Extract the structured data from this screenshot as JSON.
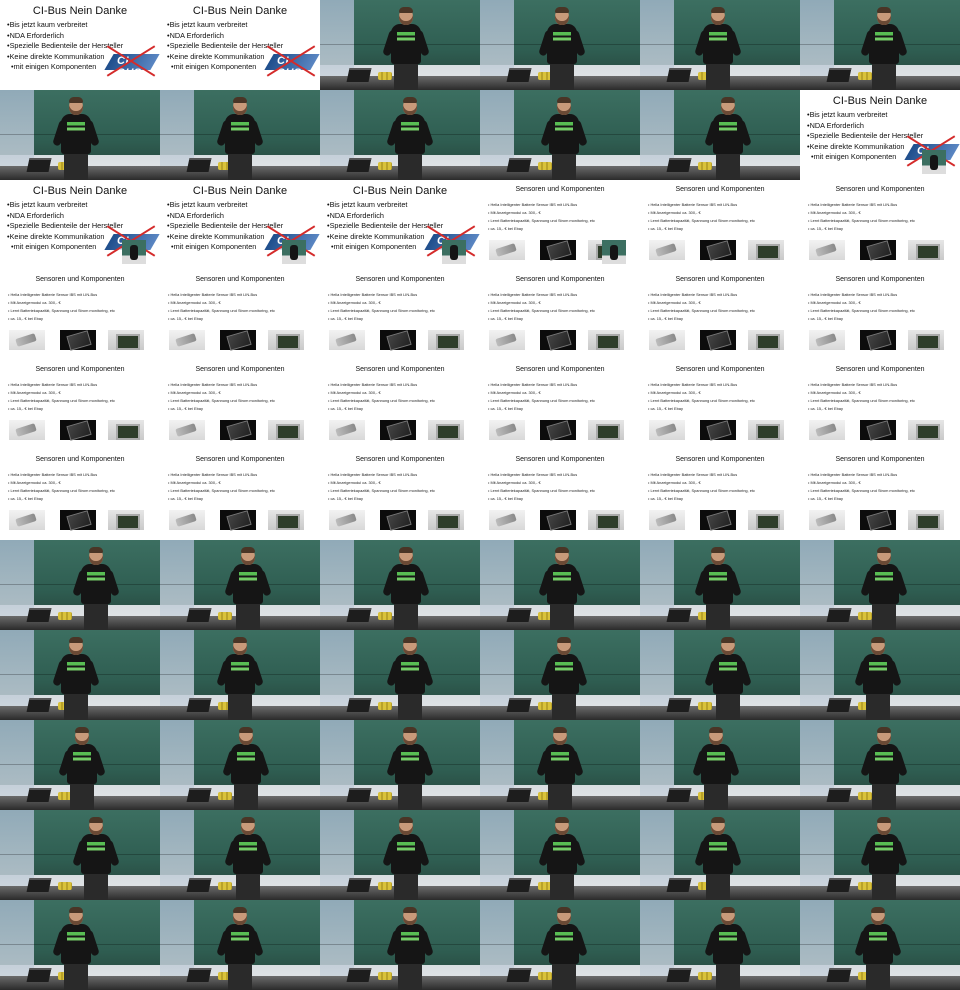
{
  "grid": {
    "columns": 6,
    "rows": 11
  },
  "slide_cibus": {
    "title": "CI-Bus Nein Danke",
    "bullets": [
      "Bis jetzt kaum verbreitet",
      "NDA Erforderlich",
      "Spezielle Bedienteile der Hersteller",
      "Keine direkte Kommunikation",
      "mit einigen Komponenten"
    ],
    "logo_text": "CI-BUS"
  },
  "slide_sensoren": {
    "title": "Sensoren und Komponenten",
    "bullets": [
      "Hella Intelligenter Batterie Sensor IBS mit LIN-Bus",
      "Mit Anzeigemodul ca. 300,- €",
      "Lernt Batteriekapazität, Spannung und Strom monitoring, etc",
      "ca. 15,- € bei Ebay"
    ]
  },
  "tiles": [
    {
      "type": "cibus"
    },
    {
      "type": "cibus"
    },
    {
      "type": "photo"
    },
    {
      "type": "photo"
    },
    {
      "type": "photo"
    },
    {
      "type": "photo"
    },
    {
      "type": "photo"
    },
    {
      "type": "photo"
    },
    {
      "type": "photo"
    },
    {
      "type": "photo"
    },
    {
      "type": "photo"
    },
    {
      "type": "cibus",
      "pip": true
    },
    {
      "type": "cibus",
      "pip": true
    },
    {
      "type": "cibus",
      "pip": true
    },
    {
      "type": "cibus",
      "pip": true
    },
    {
      "type": "sensoren",
      "pip": true
    },
    {
      "type": "sensoren"
    },
    {
      "type": "sensoren"
    },
    {
      "type": "sensoren"
    },
    {
      "type": "sensoren"
    },
    {
      "type": "sensoren"
    },
    {
      "type": "sensoren"
    },
    {
      "type": "sensoren"
    },
    {
      "type": "sensoren"
    },
    {
      "type": "sensoren"
    },
    {
      "type": "sensoren"
    },
    {
      "type": "sensoren"
    },
    {
      "type": "sensoren"
    },
    {
      "type": "sensoren"
    },
    {
      "type": "sensoren"
    },
    {
      "type": "sensoren"
    },
    {
      "type": "sensoren"
    },
    {
      "type": "sensoren"
    },
    {
      "type": "sensoren"
    },
    {
      "type": "sensoren"
    },
    {
      "type": "sensoren"
    },
    {
      "type": "photo"
    },
    {
      "type": "photo"
    },
    {
      "type": "photo"
    },
    {
      "type": "photo"
    },
    {
      "type": "photo"
    },
    {
      "type": "photo"
    },
    {
      "type": "photo"
    },
    {
      "type": "photo"
    },
    {
      "type": "photo"
    },
    {
      "type": "photo"
    },
    {
      "type": "photo"
    },
    {
      "type": "photo"
    },
    {
      "type": "photo"
    },
    {
      "type": "photo"
    },
    {
      "type": "photo"
    },
    {
      "type": "photo"
    },
    {
      "type": "photo"
    },
    {
      "type": "photo"
    },
    {
      "type": "photo"
    },
    {
      "type": "photo"
    },
    {
      "type": "photo"
    },
    {
      "type": "photo"
    },
    {
      "type": "photo"
    },
    {
      "type": "photo"
    },
    {
      "type": "photo"
    },
    {
      "type": "photo"
    },
    {
      "type": "photo"
    },
    {
      "type": "photo"
    },
    {
      "type": "photo"
    },
    {
      "type": "photo"
    }
  ]
}
